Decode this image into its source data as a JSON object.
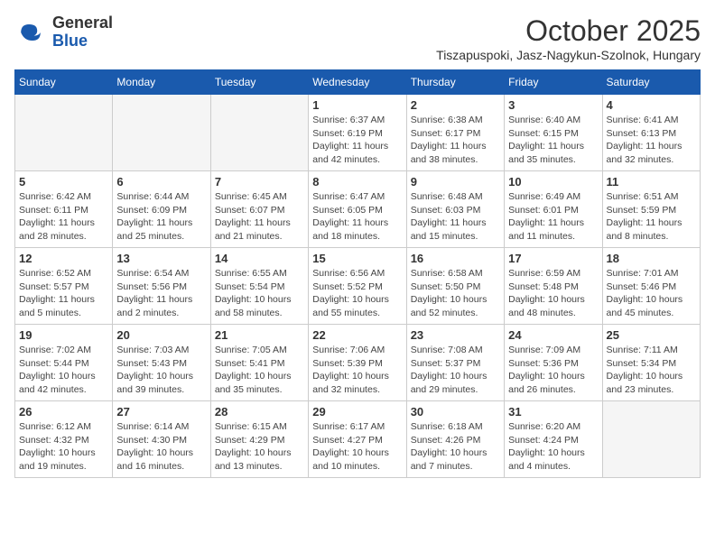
{
  "header": {
    "logo_general": "General",
    "logo_blue": "Blue",
    "month_title": "October 2025",
    "subtitle": "Tiszapuspoki, Jasz-Nagykun-Szolnok, Hungary"
  },
  "weekdays": [
    "Sunday",
    "Monday",
    "Tuesday",
    "Wednesday",
    "Thursday",
    "Friday",
    "Saturday"
  ],
  "weeks": [
    [
      {
        "day": "",
        "info": ""
      },
      {
        "day": "",
        "info": ""
      },
      {
        "day": "",
        "info": ""
      },
      {
        "day": "1",
        "info": "Sunrise: 6:37 AM\nSunset: 6:19 PM\nDaylight: 11 hours\nand 42 minutes."
      },
      {
        "day": "2",
        "info": "Sunrise: 6:38 AM\nSunset: 6:17 PM\nDaylight: 11 hours\nand 38 minutes."
      },
      {
        "day": "3",
        "info": "Sunrise: 6:40 AM\nSunset: 6:15 PM\nDaylight: 11 hours\nand 35 minutes."
      },
      {
        "day": "4",
        "info": "Sunrise: 6:41 AM\nSunset: 6:13 PM\nDaylight: 11 hours\nand 32 minutes."
      }
    ],
    [
      {
        "day": "5",
        "info": "Sunrise: 6:42 AM\nSunset: 6:11 PM\nDaylight: 11 hours\nand 28 minutes."
      },
      {
        "day": "6",
        "info": "Sunrise: 6:44 AM\nSunset: 6:09 PM\nDaylight: 11 hours\nand 25 minutes."
      },
      {
        "day": "7",
        "info": "Sunrise: 6:45 AM\nSunset: 6:07 PM\nDaylight: 11 hours\nand 21 minutes."
      },
      {
        "day": "8",
        "info": "Sunrise: 6:47 AM\nSunset: 6:05 PM\nDaylight: 11 hours\nand 18 minutes."
      },
      {
        "day": "9",
        "info": "Sunrise: 6:48 AM\nSunset: 6:03 PM\nDaylight: 11 hours\nand 15 minutes."
      },
      {
        "day": "10",
        "info": "Sunrise: 6:49 AM\nSunset: 6:01 PM\nDaylight: 11 hours\nand 11 minutes."
      },
      {
        "day": "11",
        "info": "Sunrise: 6:51 AM\nSunset: 5:59 PM\nDaylight: 11 hours\nand 8 minutes."
      }
    ],
    [
      {
        "day": "12",
        "info": "Sunrise: 6:52 AM\nSunset: 5:57 PM\nDaylight: 11 hours\nand 5 minutes."
      },
      {
        "day": "13",
        "info": "Sunrise: 6:54 AM\nSunset: 5:56 PM\nDaylight: 11 hours\nand 2 minutes."
      },
      {
        "day": "14",
        "info": "Sunrise: 6:55 AM\nSunset: 5:54 PM\nDaylight: 10 hours\nand 58 minutes."
      },
      {
        "day": "15",
        "info": "Sunrise: 6:56 AM\nSunset: 5:52 PM\nDaylight: 10 hours\nand 55 minutes."
      },
      {
        "day": "16",
        "info": "Sunrise: 6:58 AM\nSunset: 5:50 PM\nDaylight: 10 hours\nand 52 minutes."
      },
      {
        "day": "17",
        "info": "Sunrise: 6:59 AM\nSunset: 5:48 PM\nDaylight: 10 hours\nand 48 minutes."
      },
      {
        "day": "18",
        "info": "Sunrise: 7:01 AM\nSunset: 5:46 PM\nDaylight: 10 hours\nand 45 minutes."
      }
    ],
    [
      {
        "day": "19",
        "info": "Sunrise: 7:02 AM\nSunset: 5:44 PM\nDaylight: 10 hours\nand 42 minutes."
      },
      {
        "day": "20",
        "info": "Sunrise: 7:03 AM\nSunset: 5:43 PM\nDaylight: 10 hours\nand 39 minutes."
      },
      {
        "day": "21",
        "info": "Sunrise: 7:05 AM\nSunset: 5:41 PM\nDaylight: 10 hours\nand 35 minutes."
      },
      {
        "day": "22",
        "info": "Sunrise: 7:06 AM\nSunset: 5:39 PM\nDaylight: 10 hours\nand 32 minutes."
      },
      {
        "day": "23",
        "info": "Sunrise: 7:08 AM\nSunset: 5:37 PM\nDaylight: 10 hours\nand 29 minutes."
      },
      {
        "day": "24",
        "info": "Sunrise: 7:09 AM\nSunset: 5:36 PM\nDaylight: 10 hours\nand 26 minutes."
      },
      {
        "day": "25",
        "info": "Sunrise: 7:11 AM\nSunset: 5:34 PM\nDaylight: 10 hours\nand 23 minutes."
      }
    ],
    [
      {
        "day": "26",
        "info": "Sunrise: 6:12 AM\nSunset: 4:32 PM\nDaylight: 10 hours\nand 19 minutes."
      },
      {
        "day": "27",
        "info": "Sunrise: 6:14 AM\nSunset: 4:30 PM\nDaylight: 10 hours\nand 16 minutes."
      },
      {
        "day": "28",
        "info": "Sunrise: 6:15 AM\nSunset: 4:29 PM\nDaylight: 10 hours\nand 13 minutes."
      },
      {
        "day": "29",
        "info": "Sunrise: 6:17 AM\nSunset: 4:27 PM\nDaylight: 10 hours\nand 10 minutes."
      },
      {
        "day": "30",
        "info": "Sunrise: 6:18 AM\nSunset: 4:26 PM\nDaylight: 10 hours\nand 7 minutes."
      },
      {
        "day": "31",
        "info": "Sunrise: 6:20 AM\nSunset: 4:24 PM\nDaylight: 10 hours\nand 4 minutes."
      },
      {
        "day": "",
        "info": ""
      }
    ]
  ]
}
